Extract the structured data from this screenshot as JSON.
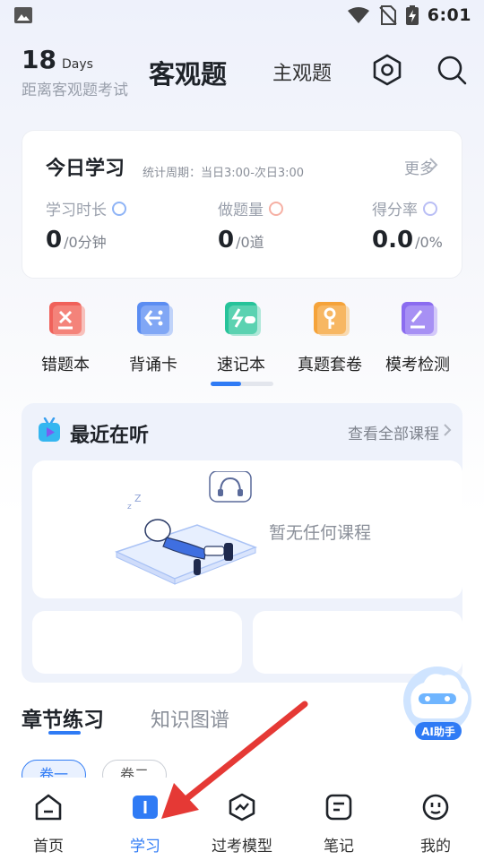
{
  "status_bar": {
    "time": "6:01"
  },
  "header": {
    "days_number": "18",
    "days_unit": "Days",
    "subtitle": "距离客观题考试",
    "tab_active": "客观题",
    "tab_inactive": "主观题"
  },
  "today": {
    "title": "今日学习",
    "period": "统计周期：当日3:00-次日3:00",
    "more": "更多",
    "stats": [
      {
        "label": "学习时长",
        "value": "0",
        "unit": "/0分钟",
        "ring_color": "#8fb4f6"
      },
      {
        "label": "做题量",
        "value": "0",
        "unit": "/0道",
        "ring_color": "#f6b0a4"
      },
      {
        "label": "得分率",
        "value": "0.0",
        "unit": "/0%",
        "ring_color": "#b9bef5"
      }
    ]
  },
  "tools": [
    {
      "label": "错题本",
      "icon": "error-book-icon",
      "color": "#f0615a"
    },
    {
      "label": "背诵卡",
      "icon": "recite-card-icon",
      "color": "#5b8df2"
    },
    {
      "label": "速记本",
      "icon": "shorthand-book-icon",
      "color": "#27c39a"
    },
    {
      "label": "真题套卷",
      "icon": "past-papers-icon",
      "color": "#f5a33a"
    },
    {
      "label": "模考检测",
      "icon": "mock-exam-icon",
      "color": "#8b6cf0"
    }
  ],
  "recent": {
    "title": "最近在听",
    "view_all": "查看全部课程",
    "empty_text": "暂无任何课程"
  },
  "ai_assistant": {
    "label": "AI助手"
  },
  "chapter": {
    "tab_active": "章节练习",
    "tab_inactive": "知识图谱",
    "chips": [
      "卷一",
      "卷二"
    ]
  },
  "bottom_nav": [
    {
      "label": "首页",
      "icon": "home-icon",
      "active": false
    },
    {
      "label": "学习",
      "icon": "study-icon",
      "active": true
    },
    {
      "label": "过考模型",
      "icon": "pass-model-icon",
      "active": false
    },
    {
      "label": "笔记",
      "icon": "notes-icon",
      "active": false
    },
    {
      "label": "我的",
      "icon": "profile-icon",
      "active": false
    }
  ],
  "colors": {
    "accent": "#2f7bf5",
    "annotation_arrow": "#e53935"
  }
}
